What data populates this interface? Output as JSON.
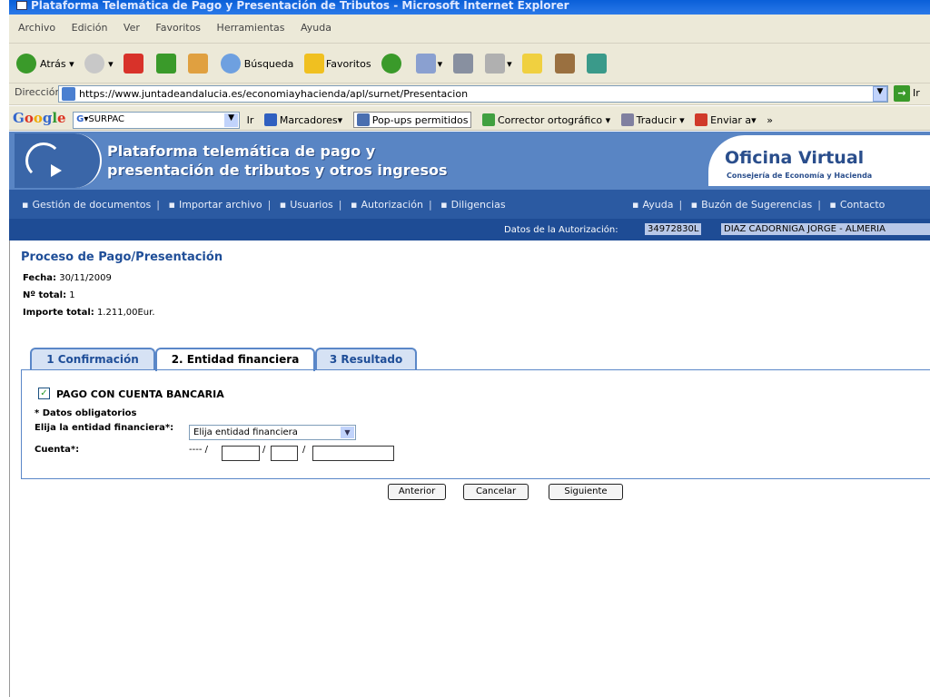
{
  "window": {
    "title": "Plataforma Telemática de Pago y Presentación de Tributos - Microsoft Internet Explorer"
  },
  "menu": [
    "Archivo",
    "Edición",
    "Ver",
    "Favoritos",
    "Herramientas",
    "Ayuda"
  ],
  "toolbar": {
    "back": "Atrás",
    "search": "Búsqueda",
    "favorites": "Favoritos"
  },
  "address": {
    "label": "Dirección",
    "url": "https://www.juntadeandalucia.es/economiayhacienda/apl/surnet/Presentacion",
    "go": "Ir"
  },
  "googlebar": {
    "search_value": "SURPAC",
    "go": "Ir",
    "bookmarks": "Marcadores",
    "popups": "Pop-ups permitidos",
    "spell": "Corrector ortográfico",
    "translate": "Traducir",
    "send": "Enviar a",
    "more": "»"
  },
  "banner": {
    "line1": "Plataforma telemática de pago y",
    "line2": "presentación de tributos y otros ingresos",
    "office": "Oficina Virtual",
    "dept": "Consejería de Economía y Hacienda"
  },
  "nav": {
    "items": [
      "Gestión de documentos",
      "Importar archivo",
      "Usuarios",
      "Autorización",
      "Diligencias"
    ],
    "right": [
      "Ayuda",
      "Buzón de Sugerencias",
      "Contacto"
    ]
  },
  "auth": {
    "label": "Datos de la Autorización:",
    "nif": "34972830L",
    "name": "DIAZ CADORNIGA JORGE - ALMERIA"
  },
  "page": {
    "title": "Proceso de Pago/Presentación",
    "fecha_label": "Fecha:",
    "fecha": "30/11/2009",
    "total_label": "Nº total:",
    "total": "1",
    "importe_label": "Importe total:",
    "importe": "1.211,00Eur."
  },
  "tabs": [
    "1 Confirmación",
    "2. Entidad financiera",
    "3 Resultado"
  ],
  "form": {
    "payment_label": "PAGO CON CUENTA BANCARIA",
    "payment_checked": true,
    "required_note": "* Datos obligatorios",
    "bank_label": "Elija la entidad financiera*:",
    "bank_value": "Elija entidad financiera",
    "account_label": "Cuenta*:",
    "account_prefix": "---- /"
  },
  "buttons": {
    "prev": "Anterior",
    "cancel": "Cancelar",
    "next": "Siguiente"
  }
}
